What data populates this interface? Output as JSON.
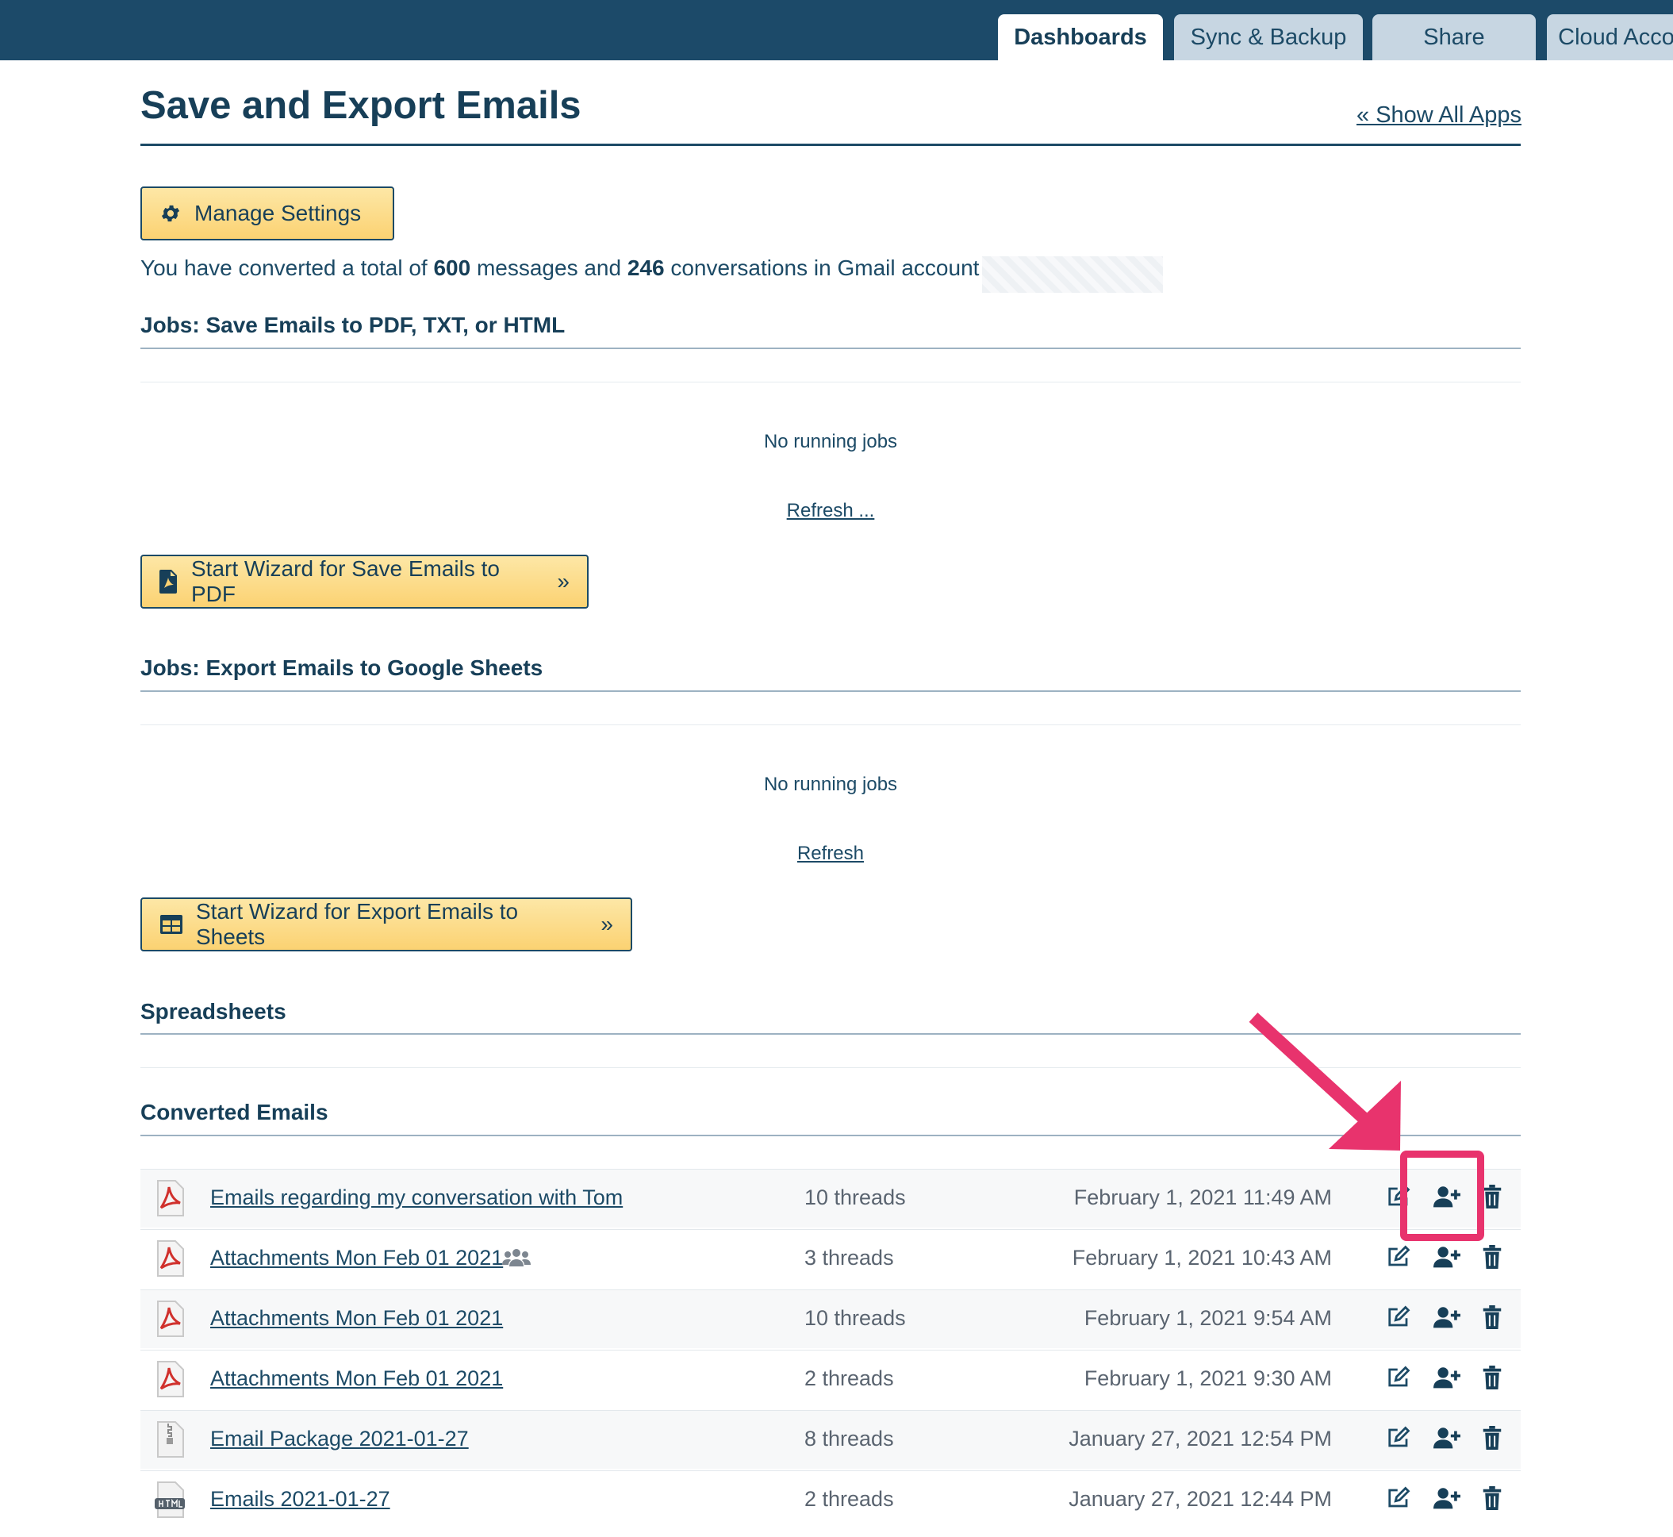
{
  "tabs": [
    {
      "label": "Dashboards",
      "active": true
    },
    {
      "label": "Sync & Backup",
      "active": false
    },
    {
      "label": "Share",
      "active": false
    },
    {
      "label": "Cloud Acco",
      "active": false
    }
  ],
  "page": {
    "title": "Save and Export Emails",
    "show_all_apps": "« Show All Apps"
  },
  "manage_settings": {
    "label": "Manage Settings",
    "icon": "gear-icon"
  },
  "summary": {
    "prefix": "You have converted a total of ",
    "messages": "600",
    "middle": " messages and ",
    "conversations": "246",
    "suffix": " conversations in Gmail account"
  },
  "pdf_jobs": {
    "title": "Jobs: Save Emails to PDF, TXT, or HTML",
    "status": "No running jobs",
    "refresh": "Refresh ...",
    "wizard_label": "Start Wizard for Save Emails to PDF",
    "wizard_chevron": "»",
    "wizard_icon": "pdf-file-icon"
  },
  "sheet_jobs": {
    "title": "Jobs: Export Emails to Google Sheets",
    "status": "No running jobs",
    "refresh": "Refresh",
    "wizard_label": "Start Wizard for Export Emails to Sheets",
    "wizard_chevron": "»",
    "wizard_icon": "table-icon"
  },
  "spreadsheets": {
    "title": "Spreadsheets"
  },
  "converted": {
    "title": "Converted Emails",
    "rows": [
      {
        "name": "Emails regarding my conversation with Tom",
        "threads": "10 threads",
        "date": "February 1, 2021 11:49 AM",
        "type": "pdf",
        "shared": false
      },
      {
        "name": "Attachments Mon Feb 01 2021",
        "threads": "3 threads",
        "date": "February 1, 2021 10:43 AM",
        "type": "pdf",
        "shared": true
      },
      {
        "name": "Attachments Mon Feb 01 2021",
        "threads": "10 threads",
        "date": "February 1, 2021 9:54 AM",
        "type": "pdf",
        "shared": false
      },
      {
        "name": "Attachments Mon Feb 01 2021",
        "threads": "2 threads",
        "date": "February 1, 2021 9:30 AM",
        "type": "pdf",
        "shared": false
      },
      {
        "name": "Email Package 2021-01-27",
        "threads": "8 threads",
        "date": "January 27, 2021 12:54 PM",
        "type": "zip",
        "shared": false
      },
      {
        "name": "Emails 2021-01-27",
        "threads": "2 threads",
        "date": "January 27, 2021 12:44 PM",
        "type": "html",
        "shared": false
      }
    ],
    "actions": [
      "edit-icon",
      "share-user-icon",
      "trash-icon"
    ]
  },
  "colors": {
    "header_bar": "#1c4a69",
    "text": "#1c4a66",
    "button_fill": "#fbd272",
    "highlight": "#e8336d"
  }
}
